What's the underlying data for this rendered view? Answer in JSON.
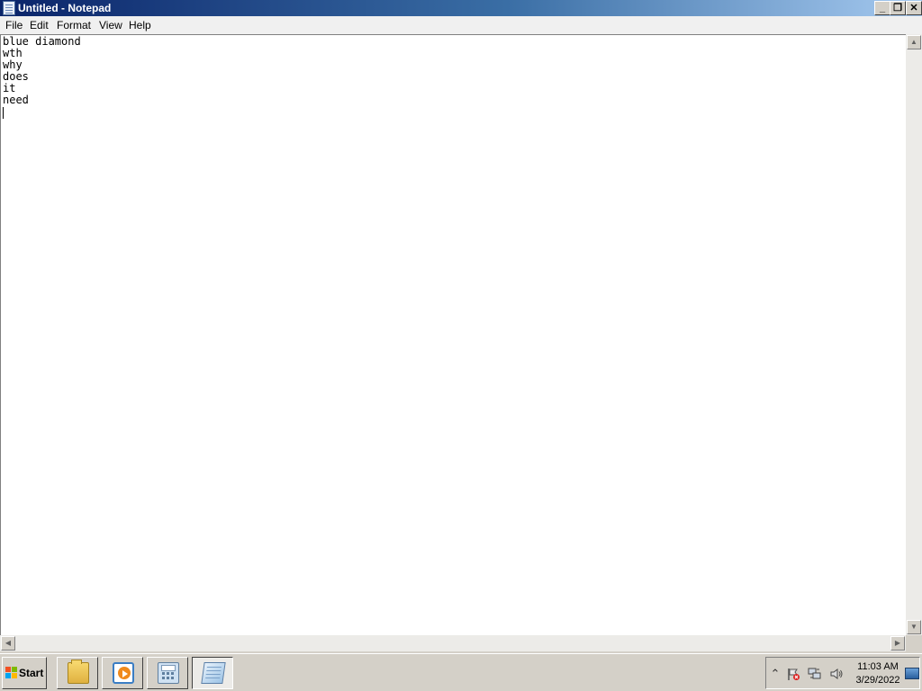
{
  "window": {
    "title": "Untitled - Notepad",
    "minimize_glyph": "_",
    "maximize_glyph": "❐",
    "close_glyph": "✕"
  },
  "menu": [
    "File",
    "Edit",
    "Format",
    "View",
    "Help"
  ],
  "editor": {
    "text": "blue diamond\nwth\nwhy\ndoes\nit\nneed\n"
  },
  "scrollbars": {
    "up_glyph": "▲",
    "down_glyph": "▼",
    "left_glyph": "◀",
    "right_glyph": "▶"
  },
  "taskbar": {
    "start_label": "Start",
    "buttons": [
      {
        "name": "explorer",
        "icon": "folder-icon"
      },
      {
        "name": "media-player",
        "icon": "media-player-icon"
      },
      {
        "name": "calculator",
        "icon": "calculator-icon"
      },
      {
        "name": "notepad",
        "icon": "notepad-icon",
        "active": true
      }
    ],
    "tray": {
      "expand_glyph": "⌃",
      "icons": [
        "action-center-flag-icon",
        "network-icon",
        "volume-icon"
      ],
      "time": "11:03 AM",
      "date": "3/29/2022"
    }
  },
  "colors": {
    "title_gradient_start": "#0a246a",
    "title_gradient_end": "#a6caf0",
    "chrome": "#d4d0c8"
  }
}
